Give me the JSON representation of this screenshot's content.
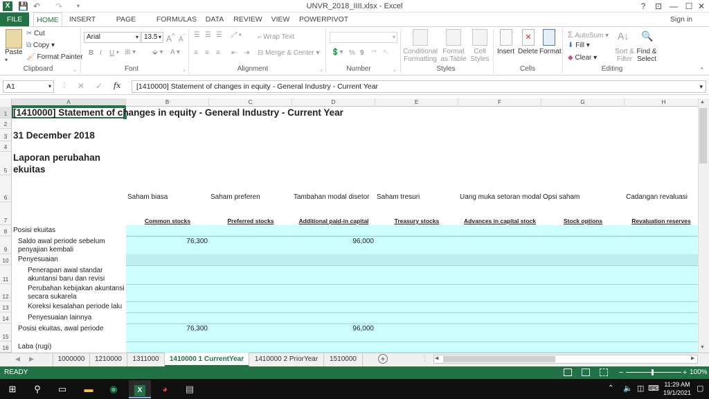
{
  "window": {
    "title": "UNVR_2018_IIII.xlsx - Excel",
    "help": "?",
    "restore": "⊡",
    "minimize": "—",
    "maximize": "☐",
    "close": "✕"
  },
  "ribbon_tabs": [
    "FILE",
    "HOME",
    "INSERT",
    "PAGE LAYOUT",
    "FORMULAS",
    "DATA",
    "REVIEW",
    "VIEW",
    "POWERPIVOT"
  ],
  "signin": "Sign in",
  "clipboard": {
    "paste": "Paste",
    "cut": "Cut",
    "copy": "Copy",
    "format_painter": "Format Painter",
    "label": "Clipboard"
  },
  "font": {
    "name": "Arial",
    "size": "13.5",
    "bold": "B",
    "italic": "I",
    "underline": "U",
    "label": "Font"
  },
  "alignment": {
    "wrap": "Wrap Text",
    "merge": "Merge & Center",
    "label": "Alignment"
  },
  "number": {
    "format": "",
    "percent": "%",
    "comma": "9",
    "label": "Number"
  },
  "styles": {
    "conditional": "Conditional Formatting",
    "format_table": "Format as Table",
    "cell_styles": "Cell Styles",
    "label": "Styles"
  },
  "cells": {
    "insert": "Insert",
    "delete": "Delete",
    "format": "Format",
    "label": "Cells"
  },
  "editing": {
    "autosum": "AutoSum",
    "fill": "Fill",
    "clear": "Clear",
    "sort": "Sort & Filter",
    "find": "Find & Select",
    "label": "Editing"
  },
  "formula_bar": {
    "name_box": "A1",
    "fx": "fx",
    "content": "[1410000] Statement of changes in equity - General Industry - Current Year"
  },
  "columns": [
    "A",
    "B",
    "C",
    "D",
    "E",
    "F",
    "G",
    "H"
  ],
  "sheet": {
    "title": "[1410000] Statement of changes in equity - General Industry - Current Year",
    "date": "31 December 2018",
    "heading_line1": "Laporan perubahan",
    "heading_line2": "ekuitas",
    "col_headers_id": [
      "Saham biasa",
      "Saham preferen",
      "Tambahan modal disetor",
      "Saham tresuri",
      "Uang muka setoran modal",
      "Opsi saham",
      "Cadangan revaluasi"
    ],
    "col_headers_en": [
      "Common stocks",
      "Preferred stocks",
      "Additional paid-in capital",
      "Treasury stocks",
      "Advances in capital stock",
      "Stock options",
      "Revaluation reserves"
    ],
    "row_labels": {
      "r8": "Posisi ekuitas",
      "r9a": "Saldo awal periode sebelum",
      "r9b": "penyajian kembali",
      "r10": "Penyesuaian",
      "r11a": "Penerapan awal standar",
      "r11b": "akuntansi baru dan revisi",
      "r12a": "Perubahan kebijakan akuntansi",
      "r12b": "secara sukarela",
      "r13": "Koreksi kesalahan periode lalu",
      "r14": "Penyesuaian lainnya",
      "r15": "Posisi ekuitas, awal periode",
      "r16": "Laba (rugi)"
    },
    "values": {
      "r9_b": "76,300",
      "r9_d": "96,000",
      "r15_b": "76,300",
      "r15_d": "96,000"
    },
    "row_numbers": [
      "1",
      "2",
      "3",
      "4",
      "5",
      "6",
      "7",
      "8",
      "9",
      "10",
      "11",
      "12",
      "13",
      "14",
      "15",
      "16"
    ]
  },
  "sheet_tabs": [
    "1000000",
    "1210000",
    "1311000",
    "1410000 1 CurrentYear",
    "1410000 2 PriorYear",
    "1510000"
  ],
  "status": {
    "ready": "READY",
    "zoom": "100%"
  },
  "clock": {
    "time": "11:29 AM",
    "date": "19/1/2021"
  }
}
